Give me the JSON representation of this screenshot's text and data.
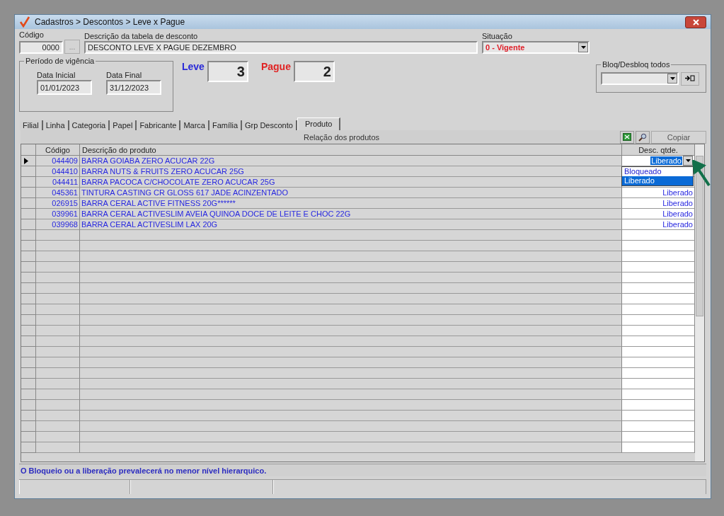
{
  "window": {
    "title": "Cadastros > Descontos > Leve x Pague"
  },
  "codigo": {
    "label": "Código",
    "value": "0000",
    "button": "..."
  },
  "descricao": {
    "label": "Descrição da tabela de desconto",
    "value": "DESCONTO LEVE X PAGUE DEZEMBRO"
  },
  "situacao": {
    "label": "Situação",
    "value": "0 - Vigente"
  },
  "periodo": {
    "title": "Período de vigência",
    "data_inicial": {
      "label": "Data Inicial",
      "value": "01/01/2023"
    },
    "data_final": {
      "label": "Data Final",
      "value": "31/12/2023"
    }
  },
  "leve": {
    "label": "Leve",
    "value": "3"
  },
  "pague": {
    "label": "Pague",
    "value": "2"
  },
  "bloq": {
    "title": "Bloq/Desbloq todos"
  },
  "tabs": [
    {
      "label": "Filial",
      "selected": false
    },
    {
      "label": "Linha",
      "selected": false
    },
    {
      "label": "Categoria",
      "selected": false
    },
    {
      "label": "Papel",
      "selected": false
    },
    {
      "label": "Fabricante",
      "selected": false
    },
    {
      "label": "Marca",
      "selected": false
    },
    {
      "label": "Família",
      "selected": false
    },
    {
      "label": "Grp Desconto",
      "selected": false
    },
    {
      "label": "Produto",
      "selected": true
    }
  ],
  "grid": {
    "caption": "Relação dos produtos",
    "copy_button": "Copiar",
    "columns": [
      "Código",
      "Descrição do produto",
      "Desc. qtde."
    ],
    "rows": [
      {
        "codigo": "044409",
        "descricao": "BARRA GOIABA ZERO ACUCAR 22G",
        "desc_qtde": "Liberado",
        "selected": true
      },
      {
        "codigo": "044410",
        "descricao": "BARRA NUTS & FRUITS ZERO ACUCAR 25G",
        "selected": false
      },
      {
        "codigo": "044411",
        "descricao": "BARRA PACOCA C/CHOCOLATE ZERO ACUCAR 25G",
        "selected": false
      },
      {
        "codigo": "045361",
        "descricao": "TINTURA CASTING CR GLOSS 617 JADE ACINZENTADO",
        "desc_qtde": "Liberado",
        "selected": false
      },
      {
        "codigo": "026915",
        "descricao": "BARRA CERAL ACTIVE FITNESS 20G******",
        "desc_qtde": "Liberado",
        "selected": false
      },
      {
        "codigo": "039961",
        "descricao": "BARRA CERAL ACTIVESLIM AVEIA QUINOA DOCE DE LEITE E CHOC 22G",
        "desc_qtde": "Liberado",
        "selected": false
      },
      {
        "codigo": "039968",
        "descricao": "BARRA CERAL ACTIVESLIM LAX 20G",
        "desc_qtde": "Liberado",
        "selected": false
      }
    ],
    "dropdown": [
      {
        "label": "Bloqueado",
        "selected": false
      },
      {
        "label": "Liberado",
        "selected": true
      }
    ]
  },
  "hint": "O Bloqueio ou a liberação prevalecerá no menor nível hierarquico."
}
